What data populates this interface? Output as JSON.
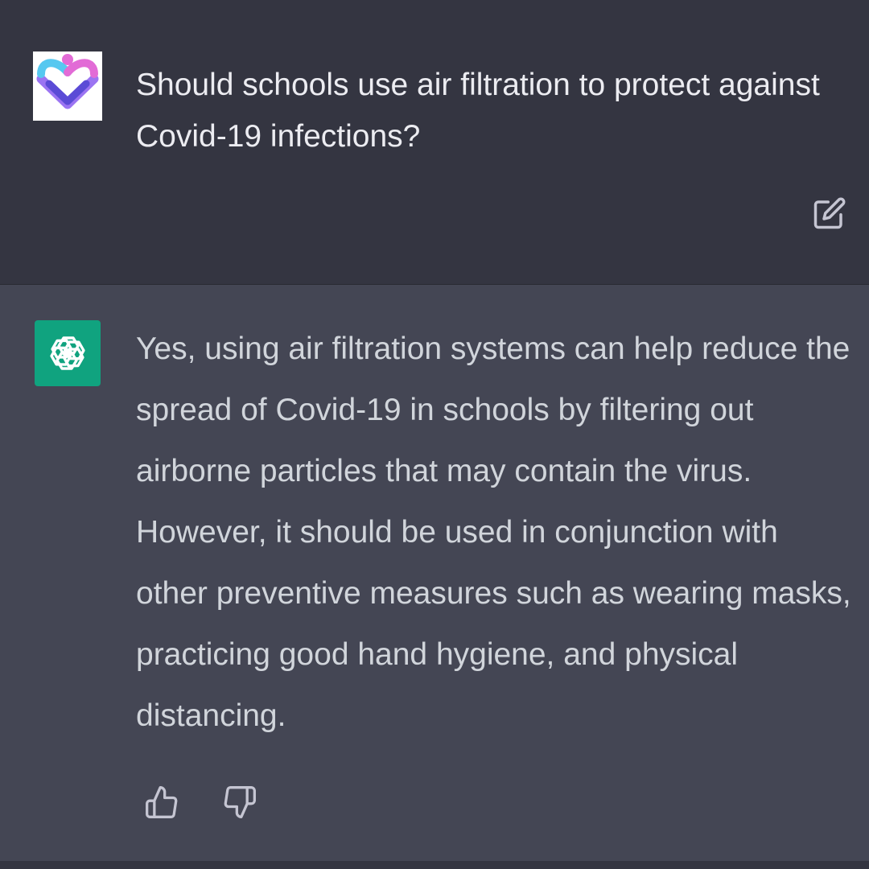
{
  "conversation": {
    "user_message": {
      "avatar_icon": "heart-logo-icon",
      "text": "Should schools use air filtration to protect against Covid-19 infections?",
      "edit_icon": "edit-icon"
    },
    "assistant_message": {
      "avatar_icon": "openai-logo-icon",
      "text": "Yes, using air filtration systems can help reduce the spread of Covid-19 in schools by filtering out airborne particles that may contain the virus. However, it should be used in conjunction with other preventive measures such as wearing masks, practicing good hand hygiene, and physical distancing.",
      "like_icon": "thumbs-up-icon",
      "dislike_icon": "thumbs-down-icon"
    }
  },
  "colors": {
    "user_bg": "#343541",
    "assistant_bg": "#444654",
    "accent": "#10a37f",
    "text": "#ececf1"
  }
}
